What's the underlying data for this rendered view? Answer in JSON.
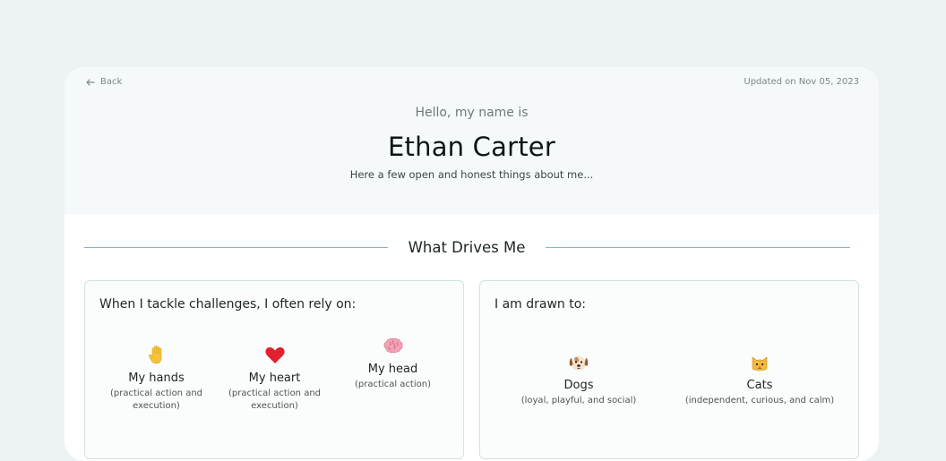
{
  "nav": {
    "back_label": "Back",
    "updated_text": "Updated on Nov 05, 2023"
  },
  "hero": {
    "greeting": "Hello, my name is",
    "name": "Ethan Carter",
    "tagline": "Here a few open and honest things about me..."
  },
  "section": {
    "title": "What Drives Me"
  },
  "challenges": {
    "title": "When I tackle challenges, I often rely on:",
    "options": [
      {
        "icon": "raised-hand-icon",
        "label": "My hands",
        "desc_line1": "(practical action and",
        "desc_line2": "execution)"
      },
      {
        "icon": "red-heart-icon",
        "label": "My heart",
        "desc_line1": "(practical action and",
        "desc_line2": "execution)"
      },
      {
        "icon": "brain-icon",
        "label": "My head",
        "desc_line1": "(practical action)",
        "desc_line2": ""
      }
    ]
  },
  "drawn": {
    "title": "I am drawn to:",
    "options": [
      {
        "icon": "dog-face-icon",
        "label": "Dogs",
        "desc": "(loyal, playful, and social)"
      },
      {
        "icon": "cat-face-icon",
        "label": "Cats",
        "desc": "(independent, curious, and calm)"
      }
    ]
  },
  "colors": {
    "page_bg": "#edf3f2",
    "hero_bg": "#f5f9f9",
    "accent_line": "#79bdb5",
    "panel_border": "#cfe3e0"
  }
}
